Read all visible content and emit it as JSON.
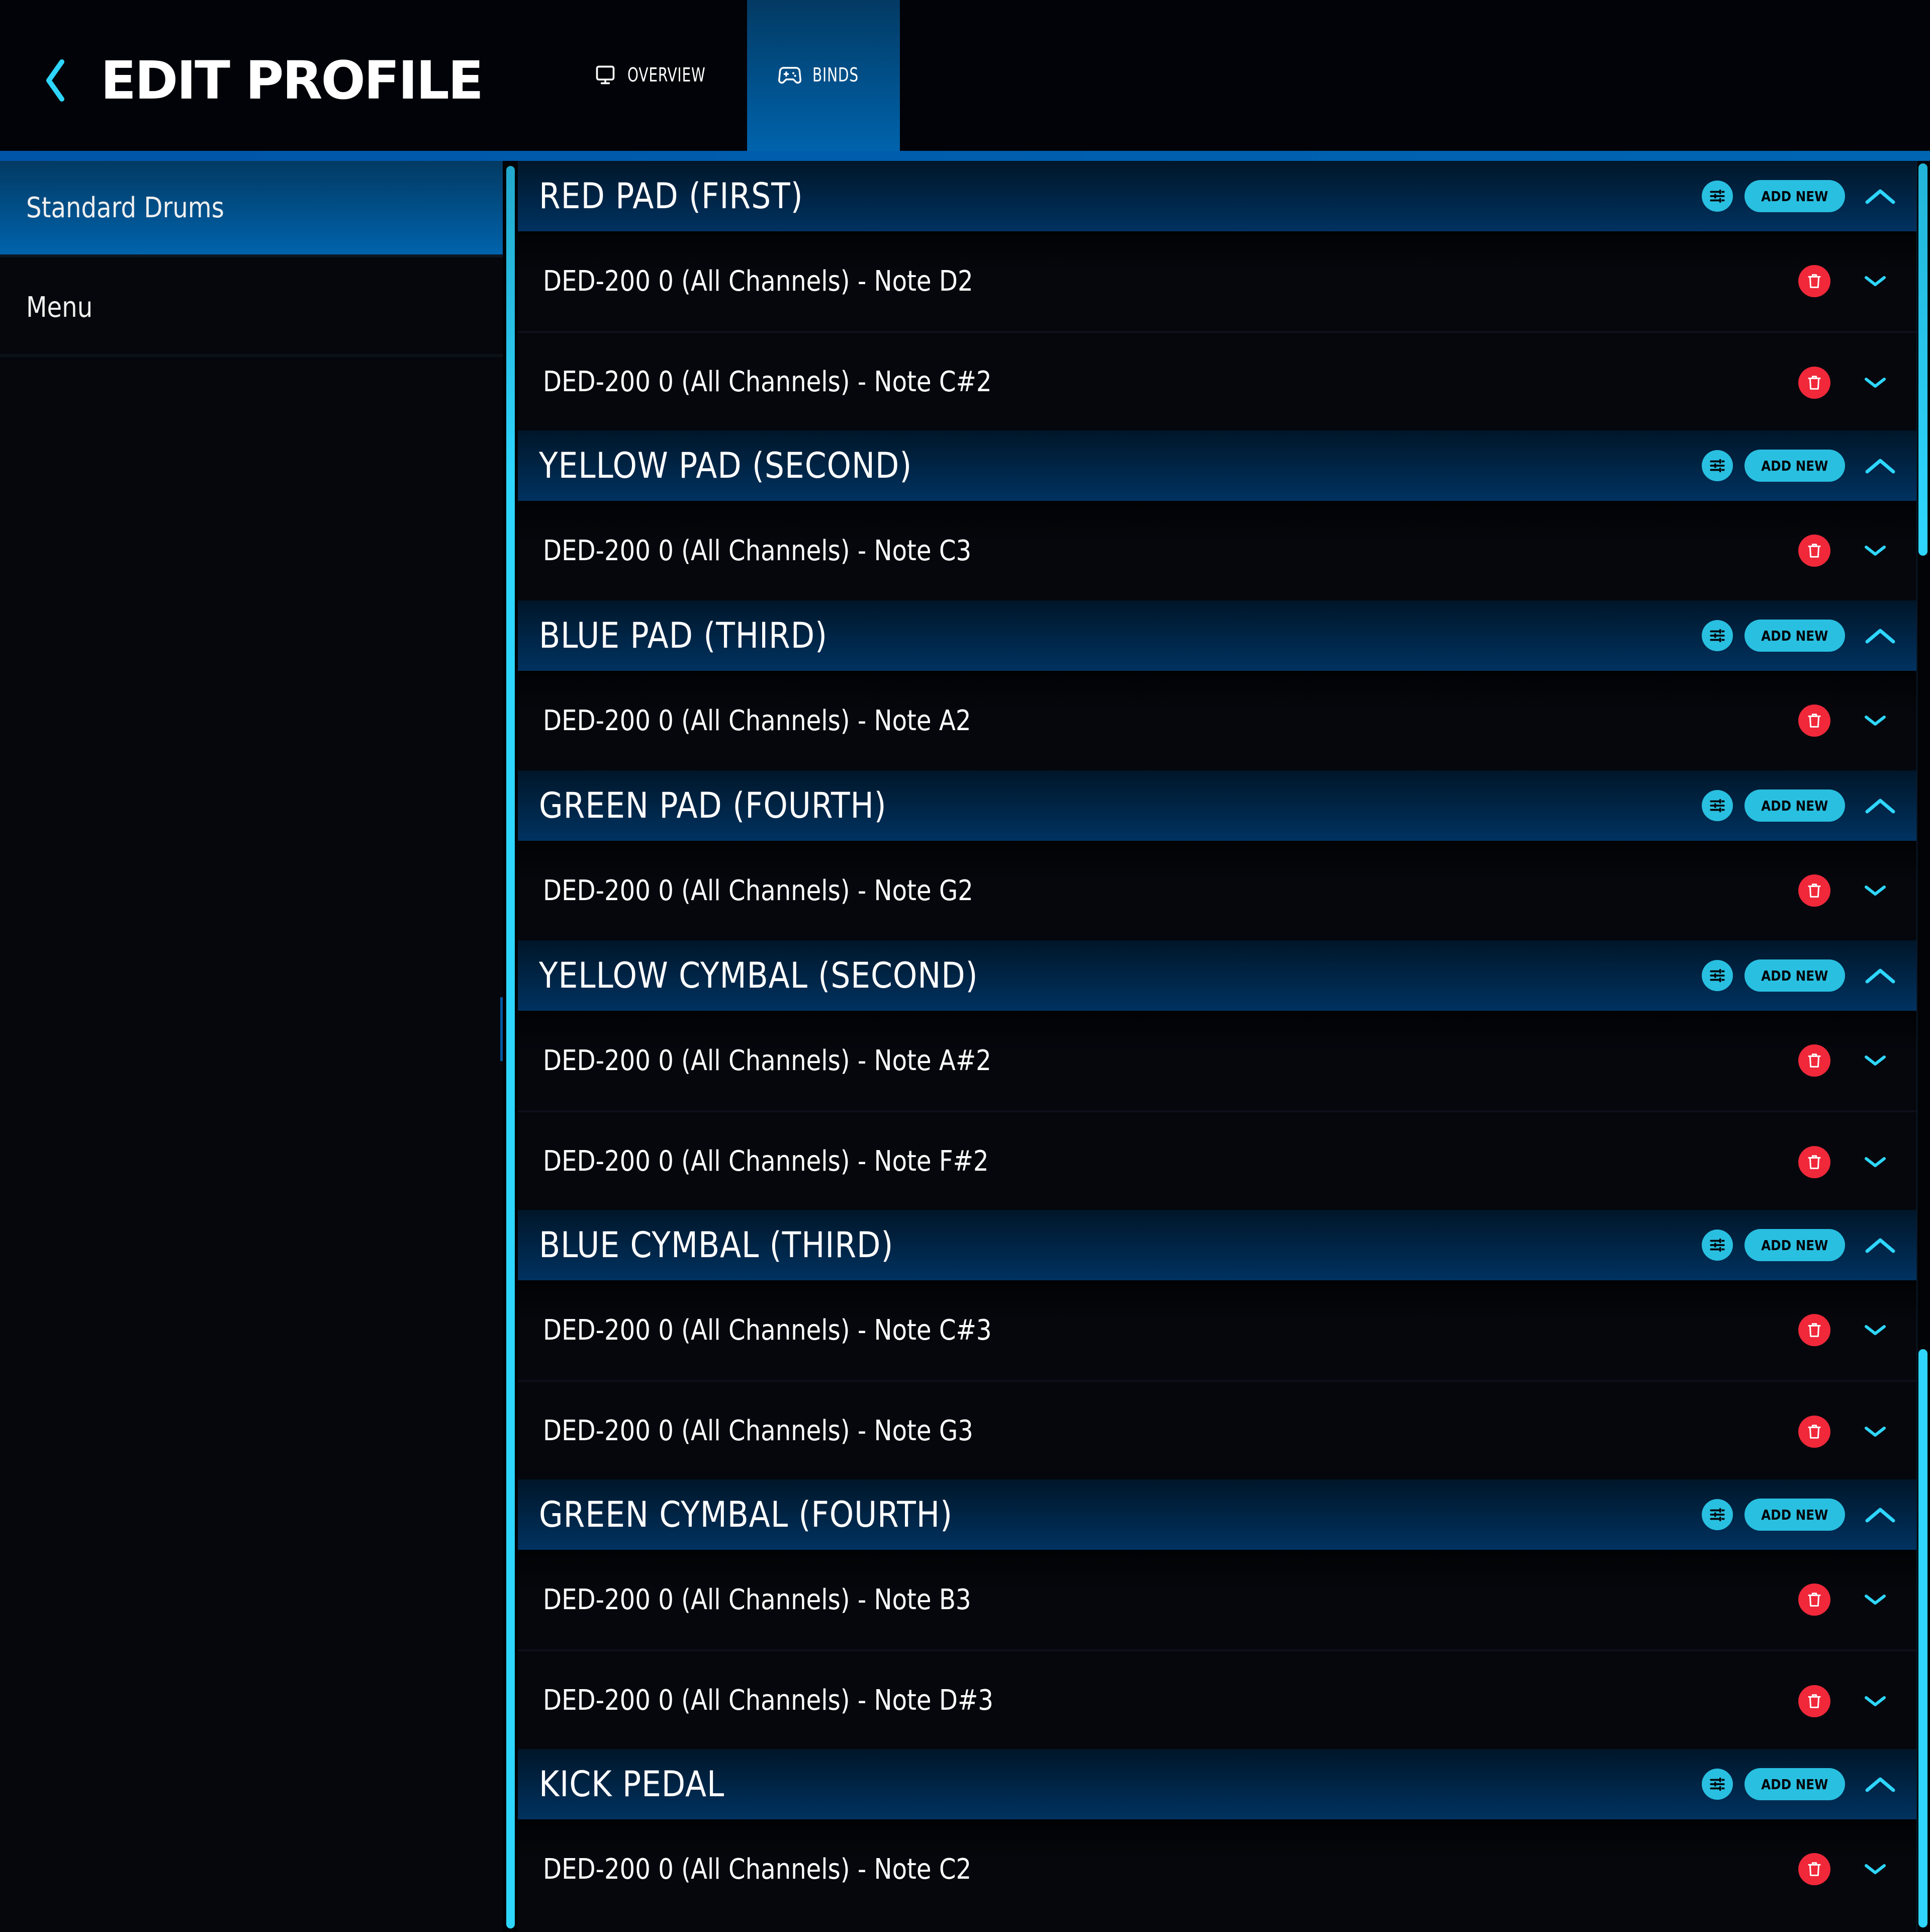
{
  "header": {
    "title": "EDIT PROFILE",
    "back_icon": "chevron-left-icon",
    "tabs": [
      {
        "label": "OVERVIEW",
        "icon": "monitor-icon",
        "active": false
      },
      {
        "label": "BINDS",
        "icon": "gamepad-icon",
        "active": true
      }
    ]
  },
  "sidebar": {
    "items": [
      {
        "label": "Standard Drums",
        "active": true
      },
      {
        "label": "Menu",
        "active": false
      }
    ]
  },
  "colors": {
    "accent": "#29bfe0",
    "delete": "#f0283a",
    "active_tab": "#0063ac",
    "section_header": "#003260",
    "background": "#05070c"
  },
  "sections": [
    {
      "name": "RED PAD (FIRST)",
      "add_label": "ADD NEW",
      "binds": [
        "DED-200 0 (All Channels) - Note D2",
        "DED-200 0 (All Channels) - Note C#2"
      ]
    },
    {
      "name": "YELLOW PAD (SECOND)",
      "add_label": "ADD NEW",
      "binds": [
        "DED-200 0 (All Channels) - Note C3"
      ]
    },
    {
      "name": "BLUE PAD (THIRD)",
      "add_label": "ADD NEW",
      "binds": [
        "DED-200 0 (All Channels) - Note A2"
      ]
    },
    {
      "name": "GREEN PAD (FOURTH)",
      "add_label": "ADD NEW",
      "binds": [
        "DED-200 0 (All Channels) - Note G2"
      ]
    },
    {
      "name": "YELLOW CYMBAL (SECOND)",
      "add_label": "ADD NEW",
      "binds": [
        "DED-200 0 (All Channels) - Note A#2",
        "DED-200 0 (All Channels) - Note F#2"
      ]
    },
    {
      "name": "BLUE CYMBAL (THIRD)",
      "add_label": "ADD NEW",
      "binds": [
        "DED-200 0 (All Channels) - Note C#3",
        "DED-200 0 (All Channels) - Note G3"
      ]
    },
    {
      "name": "GREEN CYMBAL (FOURTH)",
      "add_label": "ADD NEW",
      "binds": [
        "DED-200 0 (All Channels) - Note B3",
        "DED-200 0 (All Channels) - Note D#3"
      ]
    },
    {
      "name": "KICK PEDAL",
      "add_label": "ADD NEW",
      "binds": [
        "DED-200 0 (All Channels) - Note C2"
      ]
    }
  ]
}
